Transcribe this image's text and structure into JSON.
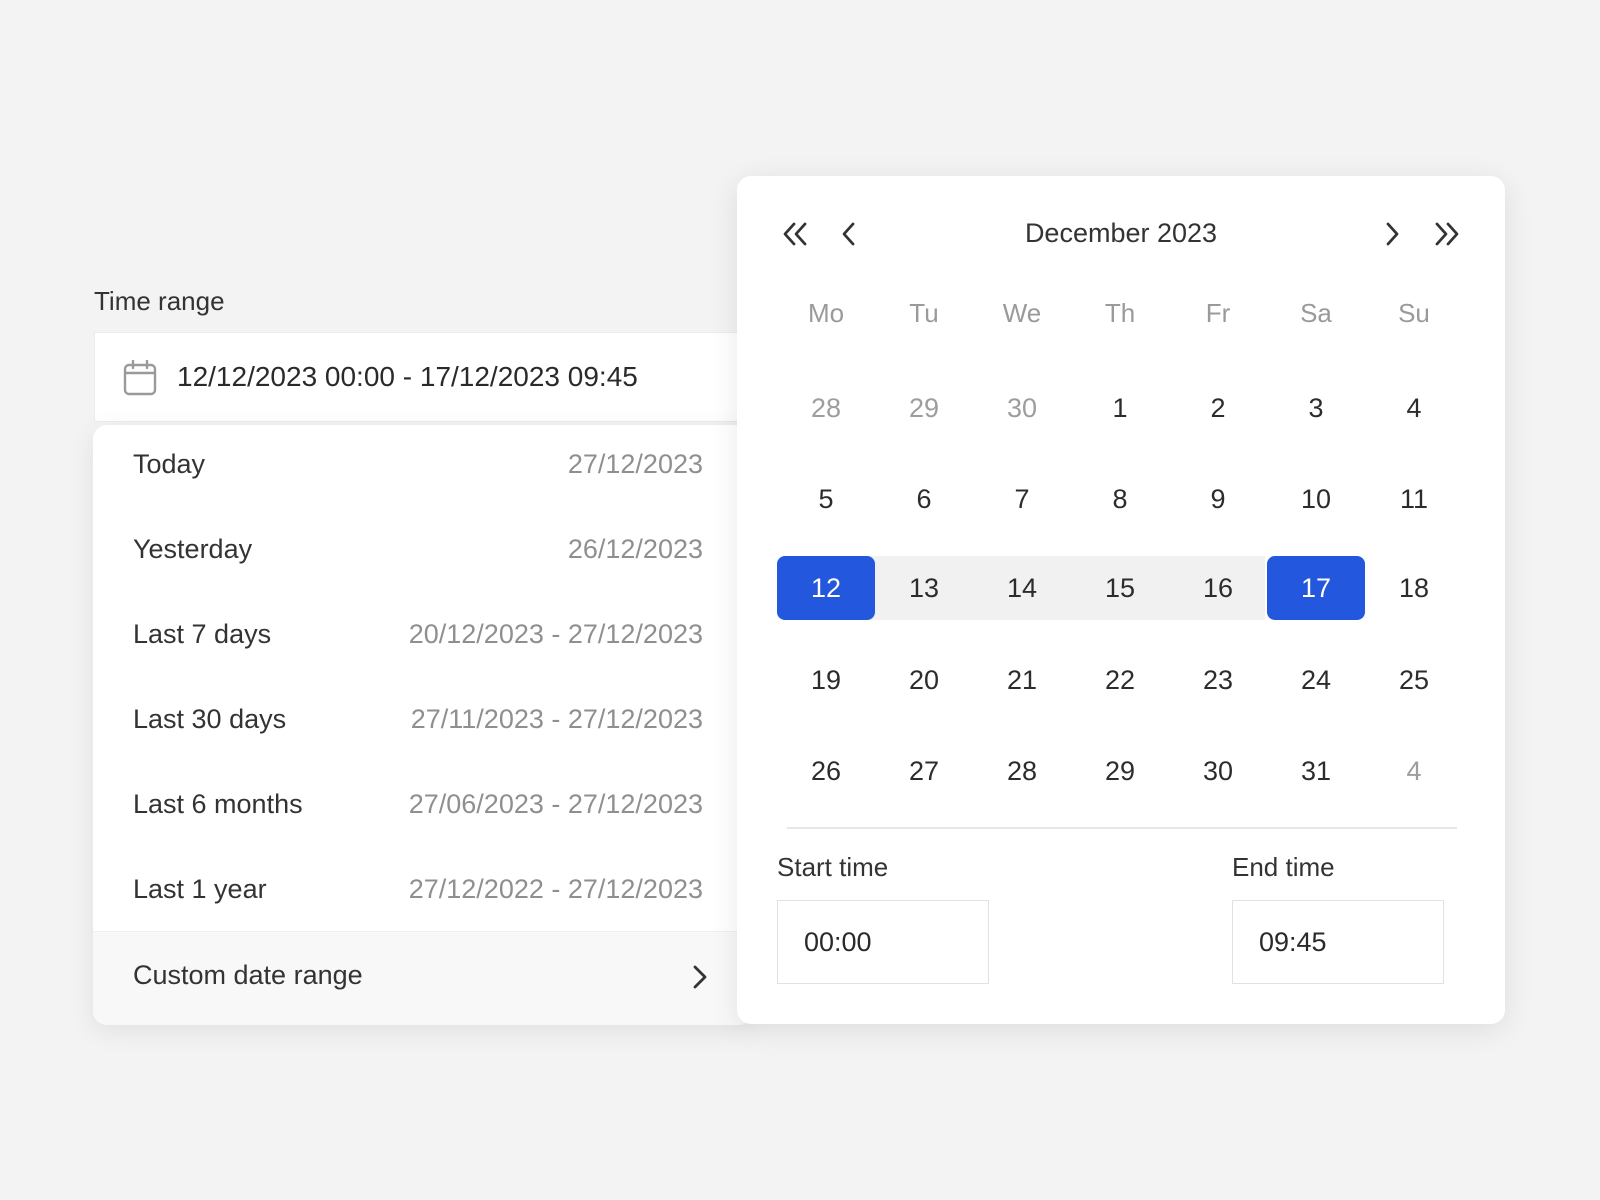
{
  "field": {
    "label": "Time range",
    "value": "12/12/2023 00:00 - 17/12/2023 09:45",
    "icon": "calendar-icon"
  },
  "presets": [
    {
      "label": "Today",
      "range": "27/12/2023"
    },
    {
      "label": "Yesterday",
      "range": "26/12/2023"
    },
    {
      "label": "Last 7 days",
      "range": "20/12/2023 - 27/12/2023"
    },
    {
      "label": "Last 30 days",
      "range": "27/11/2023 - 27/12/2023"
    },
    {
      "label": "Last 6 months",
      "range": "27/06/2023 - 27/12/2023"
    },
    {
      "label": "Last 1 year",
      "range": "27/12/2022 - 27/12/2023"
    }
  ],
  "custom": {
    "label": "Custom date range",
    "icon": "chevron-right-icon"
  },
  "calendar": {
    "month_title": "December 2023",
    "nav_icons": [
      "double-chevron-left-icon",
      "chevron-left-icon",
      "chevron-right-icon",
      "double-chevron-right-icon"
    ],
    "weekdays": [
      "Mo",
      "Tu",
      "We",
      "Th",
      "Fr",
      "Sa",
      "Su"
    ],
    "weeks": [
      [
        {
          "d": "28",
          "muted": true
        },
        {
          "d": "29",
          "muted": true
        },
        {
          "d": "30",
          "muted": true
        },
        {
          "d": "1"
        },
        {
          "d": "2"
        },
        {
          "d": "3"
        },
        {
          "d": "4"
        }
      ],
      [
        {
          "d": "5"
        },
        {
          "d": "6"
        },
        {
          "d": "7"
        },
        {
          "d": "8"
        },
        {
          "d": "9"
        },
        {
          "d": "10"
        },
        {
          "d": "11"
        }
      ],
      [
        {
          "d": "12",
          "selected": true
        },
        {
          "d": "13",
          "in_range": true
        },
        {
          "d": "14",
          "in_range": true
        },
        {
          "d": "15",
          "in_range": true
        },
        {
          "d": "16",
          "in_range": true
        },
        {
          "d": "17",
          "selected": true
        },
        {
          "d": "18"
        }
      ],
      [
        {
          "d": "19"
        },
        {
          "d": "20"
        },
        {
          "d": "21"
        },
        {
          "d": "22"
        },
        {
          "d": "23"
        },
        {
          "d": "24"
        },
        {
          "d": "25"
        }
      ],
      [
        {
          "d": "26"
        },
        {
          "d": "27"
        },
        {
          "d": "28"
        },
        {
          "d": "29"
        },
        {
          "d": "30"
        },
        {
          "d": "31"
        },
        {
          "d": "4",
          "muted": true
        }
      ]
    ],
    "selected_color": "#2357dd",
    "range_color": "#f1f1f1"
  },
  "time": {
    "start_label": "Start time",
    "start_value": "00:00",
    "end_label": "End time",
    "end_value": "09:45"
  }
}
